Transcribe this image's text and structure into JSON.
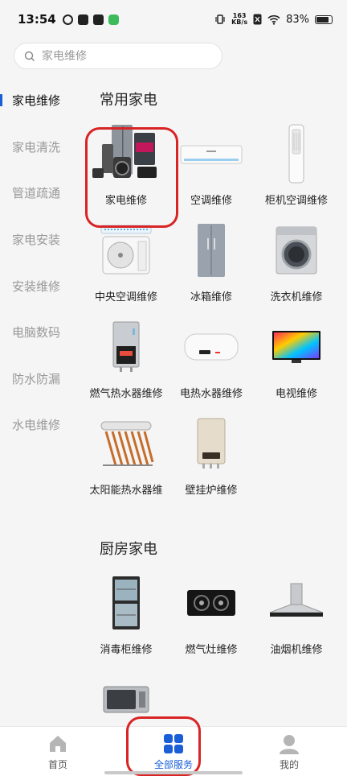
{
  "status": {
    "time": "13:54",
    "speed_value": "163",
    "speed_unit": "KB/s",
    "battery": "83%"
  },
  "search": {
    "placeholder": "家电维修"
  },
  "sidebar": {
    "items": [
      {
        "label": "家电维修"
      },
      {
        "label": "家电清洗"
      },
      {
        "label": "管道疏通"
      },
      {
        "label": "家电安装"
      },
      {
        "label": "安装维修"
      },
      {
        "label": "电脑数码"
      },
      {
        "label": "防水防漏"
      },
      {
        "label": "水电维修"
      }
    ]
  },
  "sections": [
    {
      "title": "常用家电",
      "items": [
        {
          "label": "家电维修",
          "icon": "appliance-bundle-icon"
        },
        {
          "label": "空调维修",
          "icon": "split-ac-icon"
        },
        {
          "label": "柜机空调维修",
          "icon": "floor-ac-icon"
        },
        {
          "label": "中央空调维修",
          "icon": "central-ac-icon"
        },
        {
          "label": "冰箱维修",
          "icon": "fridge-icon"
        },
        {
          "label": "洗衣机维修",
          "icon": "washer-icon"
        },
        {
          "label": "燃气热水器维修",
          "icon": "gas-heater-icon"
        },
        {
          "label": "电热水器维修",
          "icon": "electric-heater-icon"
        },
        {
          "label": "电视维修",
          "icon": "tv-icon"
        },
        {
          "label": "太阳能热水器维",
          "icon": "solar-heater-icon"
        },
        {
          "label": "壁挂炉维修",
          "icon": "wall-boiler-icon"
        }
      ]
    },
    {
      "title": "厨房家电",
      "items": [
        {
          "label": "消毒柜维修",
          "icon": "sterilizer-icon"
        },
        {
          "label": "燃气灶维修",
          "icon": "gas-stove-icon"
        },
        {
          "label": "油烟机维修",
          "icon": "range-hood-icon"
        },
        {
          "label": "",
          "icon": "microwave-icon"
        }
      ]
    }
  ],
  "nav": {
    "home": "首页",
    "services": "全部服务",
    "mine": "我的"
  },
  "colors": {
    "accent": "#1a5fd6",
    "highlight": "#d82424"
  }
}
